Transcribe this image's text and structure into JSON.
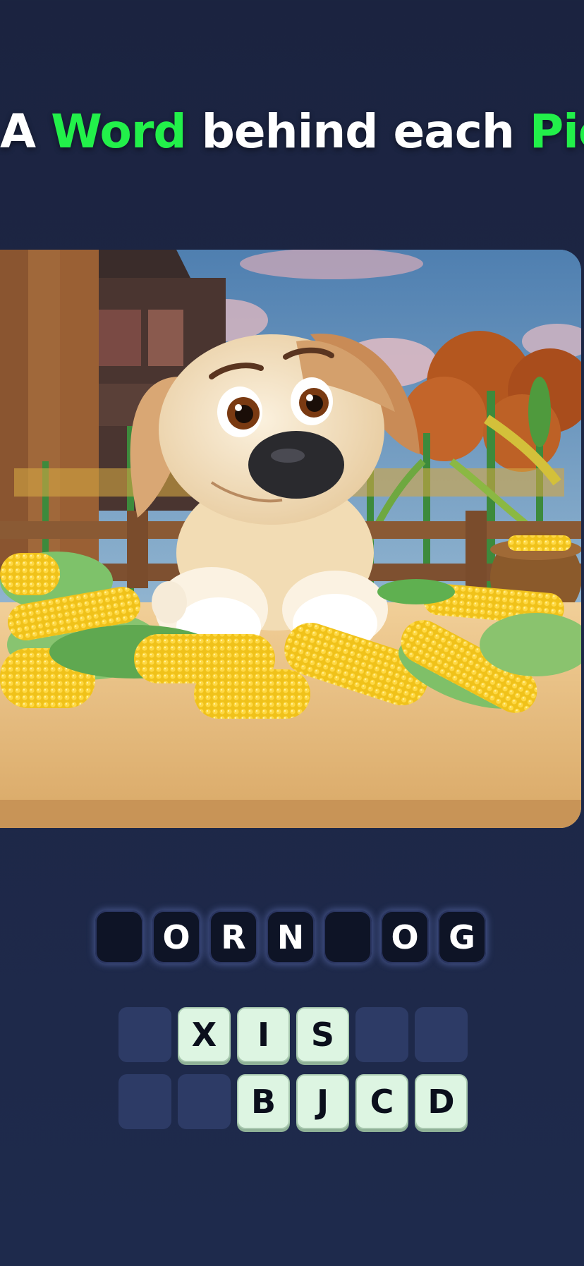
{
  "title": {
    "part1": "A ",
    "part2": "Word",
    "part3": " behind each ",
    "part4": "Pic"
  },
  "colors": {
    "highlight": "#22f04a",
    "background": "#1d2746",
    "tile_fill": "#ddf5e2",
    "empty_tile": "#2d3b66"
  },
  "picture": {
    "description_icon": "dog-with-corn-image"
  },
  "answer": {
    "slots": [
      "",
      "O",
      "R",
      "N",
      "",
      "O",
      "G"
    ]
  },
  "letters": {
    "row1": [
      "",
      "X",
      "I",
      "S",
      "",
      ""
    ],
    "row2": [
      "",
      "",
      "B",
      "J",
      "C",
      "D"
    ]
  }
}
